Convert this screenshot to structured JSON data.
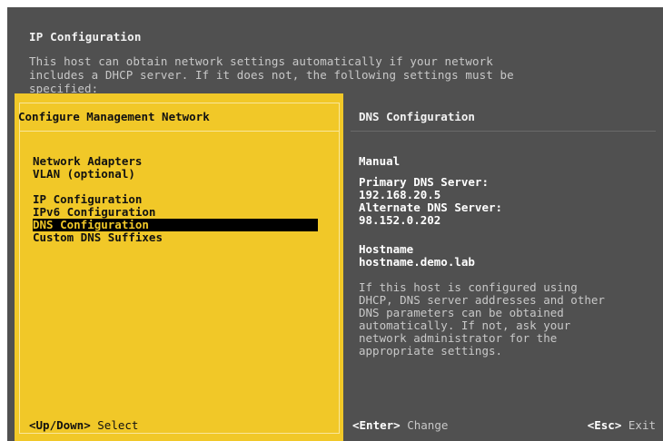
{
  "background": {
    "title": "IP Configuration",
    "description_lines": [
      "This host can obtain network settings automatically if your network",
      "includes a DHCP server. If it does not, the following settings must be",
      "specified:"
    ]
  },
  "left_panel": {
    "title": "Configure Management Network",
    "menu": [
      "Network Adapters",
      "VLAN (optional)",
      "",
      "IP Configuration",
      "IPv6 Configuration",
      "DNS Configuration",
      "Custom DNS Suffixes"
    ],
    "selected_index": 5,
    "footer": {
      "key": "<Up/Down>",
      "action": "Select"
    }
  },
  "right_panel": {
    "title": "DNS Configuration",
    "mode": "Manual",
    "primary_dns_label": "Primary DNS Server:",
    "primary_dns_value": "192.168.20.5",
    "alternate_dns_label": "Alternate DNS Server:",
    "alternate_dns_value": "98.152.0.202",
    "hostname_label": "Hostname",
    "hostname_value": "hostname.demo.lab",
    "help_lines": [
      "If this host is configured using",
      "DHCP, DNS server addresses and other",
      "DNS parameters can be obtained",
      "automatically. If not, ask your",
      "network administrator for the",
      "appropriate settings."
    ],
    "footer_enter_key": "<Enter>",
    "footer_enter_action": "Change",
    "footer_esc_key": "<Esc>",
    "footer_esc_action": "Exit"
  },
  "colors": {
    "panel_yellow": "#f1c828",
    "background_gray": "#505050",
    "selection_black": "#000000"
  }
}
